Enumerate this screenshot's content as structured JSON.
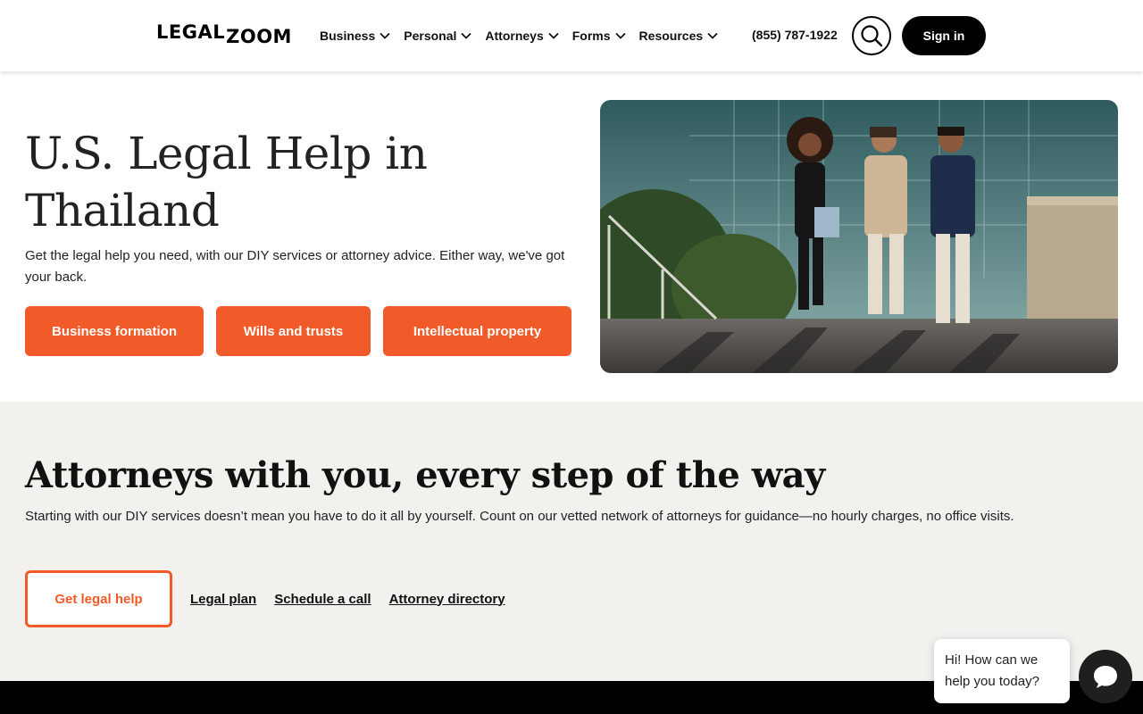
{
  "header": {
    "logo": {
      "part1": "LEGAL",
      "part2": "ZOOM"
    },
    "nav": [
      {
        "label": "Business"
      },
      {
        "label": "Personal"
      },
      {
        "label": "Attorneys"
      },
      {
        "label": "Forms"
      },
      {
        "label": "Resources"
      }
    ],
    "phone": "(855) 787-1922",
    "search_icon": "search-icon",
    "signin_label": "Sign in"
  },
  "hero": {
    "title": "U.S. Legal Help in Thailand",
    "subtitle": "Get the legal help you need, with our DIY services or attorney advice. Either way, we've got your back.",
    "buttons": [
      {
        "label": "Business formation"
      },
      {
        "label": "Wills and trusts"
      },
      {
        "label": "Intellectual property"
      }
    ]
  },
  "attorneys": {
    "title": "Attorneys with you, every step of the way",
    "subtitle": "Starting with our DIY services doesn’t mean you have to do it all by yourself. Count on our vetted network of attorneys for guidance—no hourly charges, no office visits.",
    "cta_label": "Get legal help",
    "links": [
      {
        "label": "Legal plan"
      },
      {
        "label": "Schedule a call"
      },
      {
        "label": "Attorney directory"
      }
    ]
  },
  "chat": {
    "message": "Hi! How can we help you today?",
    "icon": "chat-icon"
  },
  "colors": {
    "accent": "#f15a29",
    "section_bg": "#f3f1ee",
    "dark": "#000000"
  }
}
